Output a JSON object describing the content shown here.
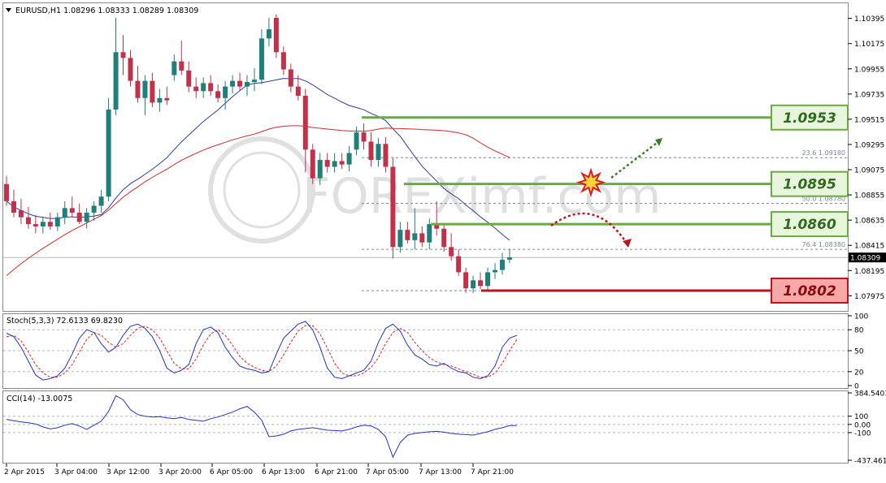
{
  "window": {
    "symbol_header": "EURUSD,H1  1.08296 1.08333 1.08289 1.08309",
    "watermark": "FOREXimf.com"
  },
  "chart_data": [
    {
      "type": "candlestick",
      "title": "EURUSD,H1  1.08296 1.08333 1.08289 1.08309",
      "ylim": [
        1.0785,
        1.1052
      ],
      "y_ticks": [
        "1.10395",
        "1.10175",
        "1.09955",
        "1.09735",
        "1.09515",
        "1.09295",
        "1.09075",
        "1.08855",
        "1.08635",
        "1.08415",
        "1.08195",
        "1.07975"
      ],
      "current_price": "1.08309",
      "x_ticks": [
        "2 Apr 2015",
        "3 Apr 04:00",
        "3 Apr 12:00",
        "3 Apr 20:00",
        "6 Apr 05:00",
        "6 Apr 13:00",
        "6 Apr 21:00",
        "7 Apr 05:00",
        "7 Apr 13:00",
        "7 Apr 21:00"
      ],
      "candles": [
        {
          "o": 1.0895,
          "h": 1.0902,
          "l": 1.0876,
          "c": 1.088
        },
        {
          "o": 1.088,
          "h": 1.089,
          "l": 1.0866,
          "c": 1.087
        },
        {
          "o": 1.0872,
          "h": 1.0882,
          "l": 1.086,
          "c": 1.0866
        },
        {
          "o": 1.0866,
          "h": 1.0875,
          "l": 1.0856,
          "c": 1.086
        },
        {
          "o": 1.086,
          "h": 1.0868,
          "l": 1.0852,
          "c": 1.0858
        },
        {
          "o": 1.0858,
          "h": 1.0866,
          "l": 1.0852,
          "c": 1.0862
        },
        {
          "o": 1.0862,
          "h": 1.087,
          "l": 1.0855,
          "c": 1.0858
        },
        {
          "o": 1.0858,
          "h": 1.087,
          "l": 1.0854,
          "c": 1.0866
        },
        {
          "o": 1.0866,
          "h": 1.088,
          "l": 1.086,
          "c": 1.0874
        },
        {
          "o": 1.0874,
          "h": 1.0884,
          "l": 1.0866,
          "c": 1.087
        },
        {
          "o": 1.087,
          "h": 1.0878,
          "l": 1.086,
          "c": 1.0862
        },
        {
          "o": 1.0862,
          "h": 1.0874,
          "l": 1.0856,
          "c": 1.087
        },
        {
          "o": 1.087,
          "h": 1.088,
          "l": 1.0863,
          "c": 1.0876
        },
        {
          "o": 1.0876,
          "h": 1.089,
          "l": 1.087,
          "c": 1.0884
        },
        {
          "o": 1.0884,
          "h": 1.097,
          "l": 1.088,
          "c": 1.096
        },
        {
          "o": 1.096,
          "h": 1.104,
          "l": 1.0955,
          "c": 1.101
        },
        {
          "o": 1.101,
          "h": 1.1025,
          "l": 1.099,
          "c": 1.1005
        },
        {
          "o": 1.1005,
          "h": 1.1012,
          "l": 1.098,
          "c": 1.0985
        },
        {
          "o": 1.0985,
          "h": 1.0998,
          "l": 1.0966,
          "c": 1.097
        },
        {
          "o": 1.097,
          "h": 1.099,
          "l": 1.0955,
          "c": 1.0985
        },
        {
          "o": 1.0985,
          "h": 1.0992,
          "l": 1.0962,
          "c": 1.0966
        },
        {
          "o": 1.0966,
          "h": 1.0978,
          "l": 1.0958,
          "c": 1.097
        },
        {
          "o": 1.097,
          "h": 1.098,
          "l": 1.0964,
          "c": 1.0968
        },
        {
          "o": 1.099,
          "h": 1.1008,
          "l": 1.0985,
          "c": 1.1002
        },
        {
          "o": 1.1002,
          "h": 1.102,
          "l": 1.099,
          "c": 1.0994
        },
        {
          "o": 1.0994,
          "h": 1.1002,
          "l": 1.0975,
          "c": 1.098
        },
        {
          "o": 1.098,
          "h": 1.0988,
          "l": 1.097,
          "c": 1.0976
        },
        {
          "o": 1.0976,
          "h": 1.0988,
          "l": 1.097,
          "c": 1.0983
        },
        {
          "o": 1.0983,
          "h": 1.099,
          "l": 1.0972,
          "c": 1.0976
        },
        {
          "o": 1.0976,
          "h": 1.0982,
          "l": 1.0966,
          "c": 1.097
        },
        {
          "o": 1.097,
          "h": 1.0985,
          "l": 1.096,
          "c": 1.098
        },
        {
          "o": 1.098,
          "h": 1.099,
          "l": 1.0974,
          "c": 1.0985
        },
        {
          "o": 1.0985,
          "h": 1.0992,
          "l": 1.0976,
          "c": 1.098
        },
        {
          "o": 1.098,
          "h": 1.099,
          "l": 1.0972,
          "c": 1.0984
        },
        {
          "o": 1.0984,
          "h": 1.0996,
          "l": 1.0976,
          "c": 1.0986
        },
        {
          "o": 1.0986,
          "h": 1.103,
          "l": 1.0982,
          "c": 1.1022
        },
        {
          "o": 1.1022,
          "h": 1.104,
          "l": 1.1015,
          "c": 1.103
        },
        {
          "o": 1.104,
          "h": 1.1043,
          "l": 1.1005,
          "c": 1.101
        },
        {
          "o": 1.101,
          "h": 1.1015,
          "l": 1.099,
          "c": 1.0995
        },
        {
          "o": 1.0995,
          "h": 1.1,
          "l": 1.0975,
          "c": 1.098
        },
        {
          "o": 1.098,
          "h": 1.099,
          "l": 1.0968,
          "c": 1.0972
        },
        {
          "o": 1.0972,
          "h": 1.0978,
          "l": 1.0905,
          "c": 1.0925
        },
        {
          "o": 1.0925,
          "h": 1.093,
          "l": 1.0895,
          "c": 1.09
        },
        {
          "o": 1.09,
          "h": 1.0922,
          "l": 1.0894,
          "c": 1.0916
        },
        {
          "o": 1.0916,
          "h": 1.0922,
          "l": 1.0905,
          "c": 1.091
        },
        {
          "o": 1.091,
          "h": 1.0922,
          "l": 1.0905,
          "c": 1.0915
        },
        {
          "o": 1.0915,
          "h": 1.0922,
          "l": 1.0908,
          "c": 1.0912
        },
        {
          "o": 1.0912,
          "h": 1.0928,
          "l": 1.0906,
          "c": 1.0922
        },
        {
          "o": 1.0925,
          "h": 1.0945,
          "l": 1.092,
          "c": 1.094
        },
        {
          "o": 1.094,
          "h": 1.0948,
          "l": 1.0925,
          "c": 1.0932
        },
        {
          "o": 1.0932,
          "h": 1.094,
          "l": 1.091,
          "c": 1.0916
        },
        {
          "o": 1.0916,
          "h": 1.0935,
          "l": 1.091,
          "c": 1.093
        },
        {
          "o": 1.093,
          "h": 1.0936,
          "l": 1.0905,
          "c": 1.091
        },
        {
          "o": 1.091,
          "h": 1.0918,
          "l": 1.083,
          "c": 1.084
        },
        {
          "o": 1.084,
          "h": 1.0862,
          "l": 1.0835,
          "c": 1.0855
        },
        {
          "o": 1.0855,
          "h": 1.0862,
          "l": 1.0843,
          "c": 1.0846
        },
        {
          "o": 1.0846,
          "h": 1.0874,
          "l": 1.0838,
          "c": 1.0852
        },
        {
          "o": 1.0852,
          "h": 1.0858,
          "l": 1.084,
          "c": 1.0844
        },
        {
          "o": 1.0844,
          "h": 1.0865,
          "l": 1.0838,
          "c": 1.086
        },
        {
          "o": 1.086,
          "h": 1.088,
          "l": 1.085,
          "c": 1.0856
        },
        {
          "o": 1.0856,
          "h": 1.086,
          "l": 1.0836,
          "c": 1.084
        },
        {
          "o": 1.084,
          "h": 1.0852,
          "l": 1.0828,
          "c": 1.0832
        },
        {
          "o": 1.0832,
          "h": 1.0838,
          "l": 1.0815,
          "c": 1.0818
        },
        {
          "o": 1.0818,
          "h": 1.0822,
          "l": 1.08,
          "c": 1.0804
        },
        {
          "o": 1.0804,
          "h": 1.0815,
          "l": 1.08,
          "c": 1.0811
        },
        {
          "o": 1.0811,
          "h": 1.0818,
          "l": 1.0803,
          "c": 1.0806
        },
        {
          "o": 1.0806,
          "h": 1.0822,
          "l": 1.0802,
          "c": 1.0818
        },
        {
          "o": 1.0818,
          "h": 1.0826,
          "l": 1.0812,
          "c": 1.082
        },
        {
          "o": 1.082,
          "h": 1.0835,
          "l": 1.0816,
          "c": 1.0829
        },
        {
          "o": 1.0829,
          "h": 1.0838,
          "l": 1.0826,
          "c": 1.0831
        }
      ],
      "fibonacci": [
        {
          "label": "23.6",
          "value": "1.09180",
          "price": 1.0918
        },
        {
          "label": "50.0",
          "value": "1.08780",
          "price": 1.0878
        },
        {
          "label": "76.4",
          "value": "1.08380",
          "price": 1.0838
        }
      ],
      "levels": [
        {
          "price": 1.0953,
          "label": "1.0953",
          "kind": "resistance"
        },
        {
          "price": 1.0895,
          "label": "1.0895",
          "kind": "resistance"
        },
        {
          "price": 1.086,
          "label": "1.0860",
          "kind": "resistance"
        },
        {
          "price": 1.0802,
          "label": "1.0802",
          "kind": "support"
        }
      ],
      "colors": {
        "bull": "#1f7f7a",
        "bear": "#c2314a",
        "ma_fast": "#2c3d9c",
        "ma_slow": "#d12a2a",
        "green_level": "#6aaa3e",
        "red_level": "#c0141c"
      }
    },
    {
      "type": "line",
      "title": "Stoch(5,3,3) 72.6133 69.8230",
      "ylim": [
        0,
        100
      ],
      "y_ticks": [
        "100",
        "80",
        "50",
        "20",
        "0"
      ],
      "series": [
        {
          "values": [
            75,
            70,
            55,
            35,
            15,
            8,
            10,
            14,
            25,
            45,
            68,
            80,
            76,
            60,
            48,
            55,
            72,
            85,
            88,
            82,
            70,
            50,
            25,
            18,
            22,
            30,
            60,
            80,
            84,
            76,
            55,
            40,
            28,
            24,
            22,
            18,
            20,
            45,
            68,
            78,
            88,
            92,
            80,
            55,
            25,
            12,
            10,
            14,
            18,
            22,
            35,
            62,
            82,
            88,
            78,
            58,
            44,
            38,
            30,
            28,
            32,
            25,
            20,
            18,
            12,
            10,
            14,
            28,
            55,
            68,
            72
          ]
        },
        {
          "values": [
            70,
            72,
            64,
            48,
            30,
            18,
            12,
            12,
            18,
            30,
            48,
            66,
            76,
            72,
            62,
            55,
            60,
            72,
            82,
            85,
            80,
            68,
            50,
            32,
            24,
            24,
            38,
            58,
            74,
            80,
            72,
            58,
            42,
            32,
            26,
            22,
            20,
            28,
            44,
            62,
            78,
            86,
            86,
            74,
            54,
            32,
            18,
            14,
            14,
            18,
            26,
            40,
            60,
            76,
            82,
            76,
            62,
            50,
            40,
            34,
            30,
            28,
            24,
            20,
            16,
            12,
            12,
            18,
            32,
            50,
            66
          ]
        }
      ]
    },
    {
      "type": "line",
      "title": "CCI(14) -13.0075",
      "ylim": [
        -437.4614,
        384.5403
      ],
      "y_ticks": [
        "384.5403",
        "100",
        "0.00",
        "-100",
        "-437.4614"
      ],
      "series": [
        {
          "values": [
            60,
            45,
            30,
            20,
            5,
            -30,
            -55,
            -40,
            -10,
            10,
            -20,
            -60,
            -10,
            40,
            160,
            350,
            300,
            180,
            120,
            100,
            90,
            95,
            80,
            70,
            85,
            60,
            50,
            40,
            70,
            90,
            120,
            150,
            190,
            220,
            150,
            50,
            -150,
            -140,
            -120,
            -80,
            -60,
            -50,
            -40,
            -55,
            -70,
            -75,
            -80,
            -60,
            -30,
            -10,
            -20,
            -60,
            -150,
            -400,
            -220,
            -130,
            -110,
            -100,
            -90,
            -85,
            -95,
            -110,
            -120,
            -125,
            -130,
            -110,
            -90,
            -60,
            -40,
            -15,
            -13
          ]
        }
      ]
    }
  ]
}
